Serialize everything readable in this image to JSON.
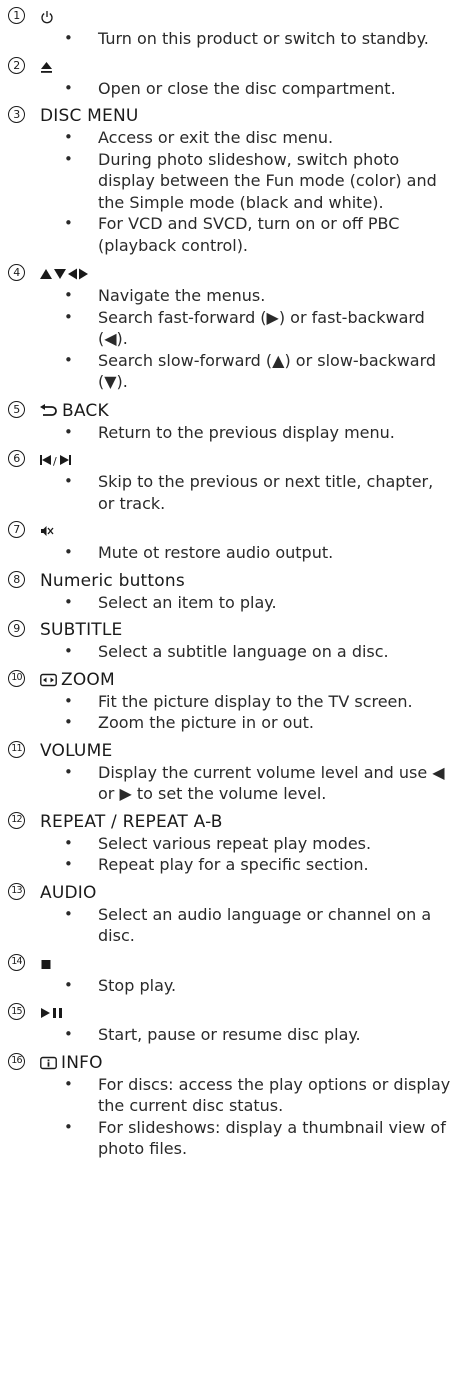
{
  "items": [
    {
      "num": "1",
      "icon": "power-icon",
      "label": "",
      "bullets": [
        "Turn on this product or switch to standby."
      ]
    },
    {
      "num": "2",
      "icon": "eject-icon",
      "label": "",
      "bullets": [
        "Open or close the disc compartment."
      ]
    },
    {
      "num": "3",
      "icon": "",
      "label": "DISC MENU",
      "bullets": [
        "Access or exit the disc menu.",
        "During photo slideshow, switch photo display between the Fun mode (color) and the Simple mode (black and white).",
        "For VCD and SVCD, turn on or off PBC (playback control)."
      ]
    },
    {
      "num": "4",
      "icon": "nav-arrows-icon",
      "label": "",
      "bullets": [
        "Navigate the menus.",
        "Search fast-forward (▶) or fast-backward (◀).",
        "Search slow-forward (▲) or slow-backward (▼)."
      ]
    },
    {
      "num": "5",
      "icon": "back-icon",
      "label": "BACK",
      "bullets": [
        "Return to the previous display menu."
      ]
    },
    {
      "num": "6",
      "icon": "prev-next-icon",
      "label": "",
      "bullets": [
        "Skip to the previous or next title, chapter, or track."
      ]
    },
    {
      "num": "7",
      "icon": "mute-icon",
      "label": "",
      "bullets": [
        "Mute ot restore audio output."
      ]
    },
    {
      "num": "8",
      "icon": "",
      "label": "Numeric buttons",
      "bullets": [
        "Select an item to play."
      ]
    },
    {
      "num": "9",
      "icon": "",
      "label": "SUBTITLE",
      "bullets": [
        "Select a subtitle language on a disc."
      ]
    },
    {
      "num": "10",
      "icon": "zoom-icon",
      "label": "ZOOM",
      "bullets": [
        "Fit the picture display to the TV screen.",
        "Zoom the picture in or out."
      ]
    },
    {
      "num": "11",
      "icon": "",
      "label": "VOLUME",
      "bullets": [
        "Display the current volume level and use ◀ or ▶ to set the volume level."
      ]
    },
    {
      "num": "12",
      "icon": "",
      "label": "REPEAT / REPEAT A-B",
      "bullets": [
        "Select various repeat play modes.",
        "Repeat play for a specific section."
      ]
    },
    {
      "num": "13",
      "icon": "",
      "label": "AUDIO",
      "bullets": [
        "Select an audio language or channel on a disc."
      ]
    },
    {
      "num": "14",
      "icon": "stop-icon",
      "label": "",
      "bullets": [
        "Stop play."
      ]
    },
    {
      "num": "15",
      "icon": "play-pause-icon",
      "label": "",
      "bullets": [
        "Start, pause or resume disc play."
      ]
    },
    {
      "num": "16",
      "icon": "info-icon",
      "label": "INFO",
      "bullets": [
        "For discs: access the play options or display the current disc status.",
        "For slideshows: display a thumbnail view of photo files."
      ]
    }
  ]
}
